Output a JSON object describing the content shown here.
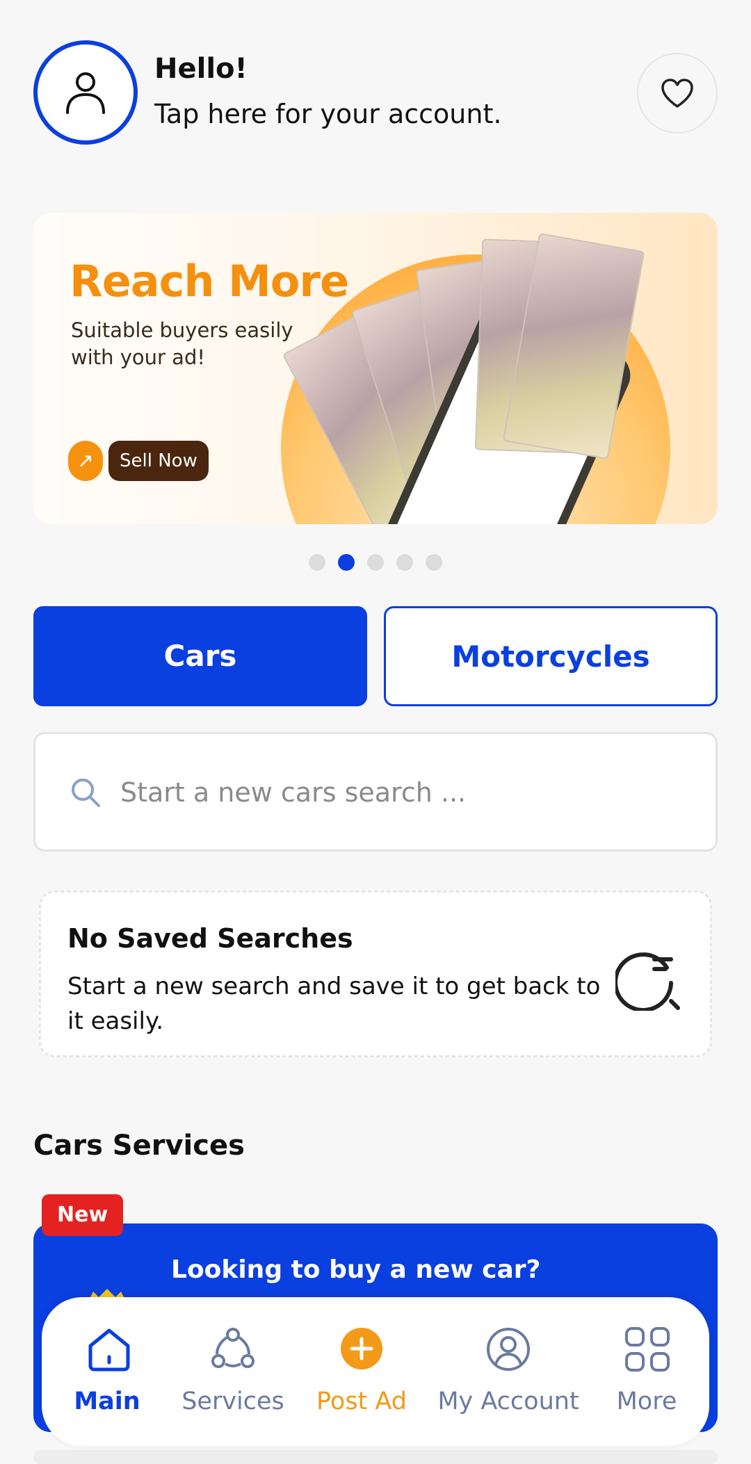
{
  "header": {
    "greeting_title": "Hello!",
    "greeting_subtitle": "Tap here for your account."
  },
  "banner": {
    "title": "Reach More",
    "subtitle": "Suitable buyers easily with your ad!",
    "cta_label": "Sell Now",
    "cta_icon": "arrow-up-right-icon",
    "colors": {
      "title": "#f5900f",
      "cta_bg": "#4a260e",
      "accent": "#f7920f"
    }
  },
  "carousel": {
    "total_dots": 5,
    "active_index": 1
  },
  "vehicle_tabs": {
    "cars_label": "Cars",
    "motorcycles_label": "Motorcycles",
    "selected": "Cars"
  },
  "search": {
    "placeholder": "Start a new cars search ..."
  },
  "saved_searches": {
    "title": "No Saved Searches",
    "description": "Start a new search and save it to get back to it easily."
  },
  "services": {
    "heading": "Cars Services",
    "promo": {
      "badge": "New",
      "text": "Looking to buy a new car?"
    }
  },
  "bottom_nav": {
    "items": [
      {
        "label": "Main",
        "icon": "home-icon",
        "active": true
      },
      {
        "label": "Services",
        "icon": "services-icon",
        "active": false
      },
      {
        "label": "Post Ad",
        "icon": "plus-circle-icon",
        "active": false
      },
      {
        "label": "My Account",
        "icon": "user-circle-icon",
        "active": false
      },
      {
        "label": "More",
        "icon": "grid-icon",
        "active": false
      }
    ]
  },
  "colors": {
    "brand_blue": "#0a3fe0",
    "accent_orange": "#f39a18",
    "badge_red": "#e52222"
  }
}
